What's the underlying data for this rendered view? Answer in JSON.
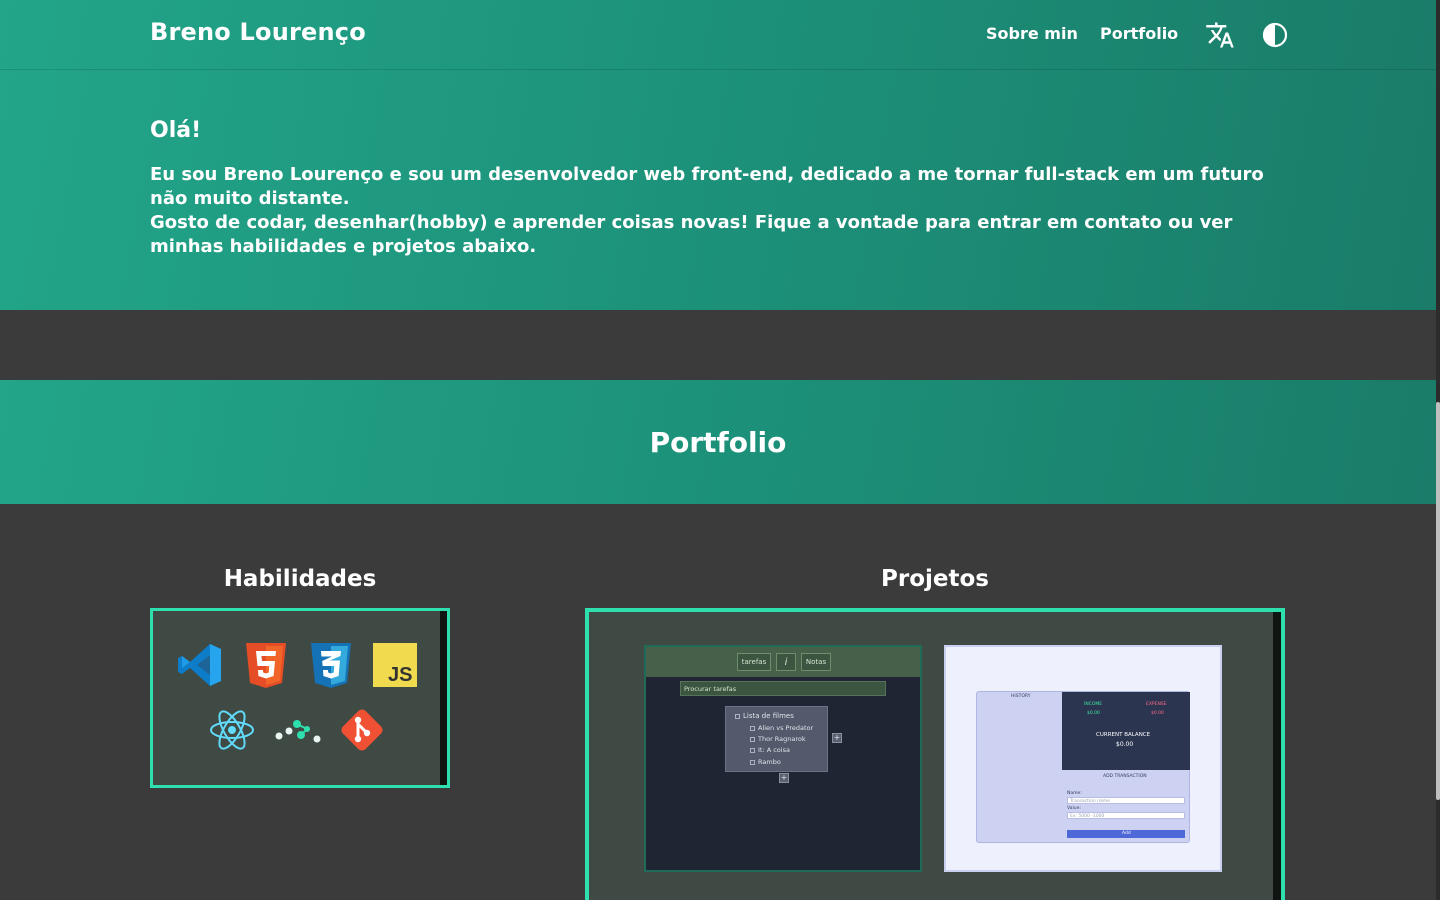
{
  "header": {
    "brand": "Breno Lourenço",
    "nav": [
      {
        "label": "Sobre min"
      },
      {
        "label": "Portfolio"
      }
    ],
    "icons": {
      "translate": "translate-icon",
      "theme": "contrast-icon"
    }
  },
  "intro": {
    "greeting": "Olá!",
    "line1": "Eu sou Breno Lourenço e sou um desenvolvedor web front-end, dedicado a me tornar full-stack em um futuro não muito distante.",
    "line2": "Gosto de codar, desenhar(hobby) e aprender coisas novas! Fique a vontade para entrar em contato ou ver minhas habilidades e projetos abaixo."
  },
  "portfolio": {
    "title": "Portfolio",
    "skills_title": "Habilidades",
    "projects_title": "Projetos",
    "skills": [
      "vscode-icon",
      "html5-icon",
      "css3-icon",
      "javascript-icon",
      "react-icon",
      "dots-logo-icon",
      "git-icon"
    ],
    "projects": [
      {
        "name": "task-app",
        "tab_left": "tarefas",
        "tab_info": "i",
        "tab_right": "Notas",
        "search": "Procurar tarefas",
        "list_title": "Lista de filmes",
        "list_items": [
          "Alien vs Predator",
          "Thor Ragnarok",
          "It: A coisa",
          "Rambo"
        ]
      },
      {
        "name": "expense-tracker",
        "history": "HISTORY",
        "income_label": "INCOME",
        "income_value": "$0.00",
        "expense_label": "EXPENSE",
        "expense_value": "$0.00",
        "balance_label": "CURRENT BALANCE",
        "balance_value": "$0.00",
        "add_title": "ADD TRANSACTION",
        "name_label": "Name:",
        "name_placeholder": "Transaction name",
        "value_label": "Value:",
        "value_placeholder": "Ex: 5000 -1000",
        "add_button": "Add"
      }
    ]
  },
  "colors": {
    "accent": "#2ee0ad",
    "teal": "#1f9980",
    "background": "#3b3b3b"
  }
}
